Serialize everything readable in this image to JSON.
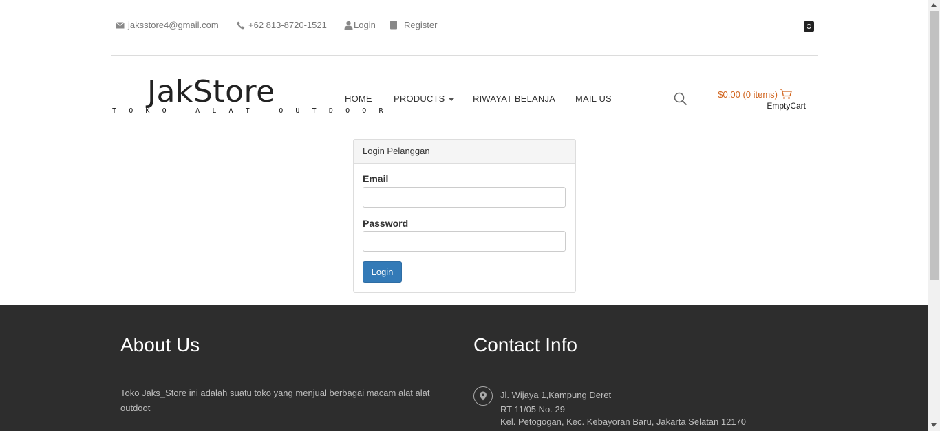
{
  "topbar": {
    "email": "jaksstore4@gmail.com",
    "phone": "+62 813-8720-1521",
    "login": "Login",
    "register": "Register",
    "social_icon": "instagram-icon"
  },
  "brand": {
    "name": "JakStore",
    "tagline": "TOKO ALAT OUTDOOR"
  },
  "nav": {
    "home": "HOME",
    "products": "PRODUCTS",
    "history": "RIWAYAT BELANJA",
    "mail": "MAIL US"
  },
  "cart": {
    "total": "$0.00 (0 items)",
    "empty": "EmptyCart"
  },
  "login_panel": {
    "title": "Login Pelanggan",
    "email_label": "Email",
    "password_label": "Password",
    "button": "Login"
  },
  "footer": {
    "about_title": "About Us",
    "about_text": "Toko Jaks_Store ini adalah suatu toko yang menjual berbagai macam alat alat outdoot",
    "contact_title": "Contact Info",
    "address_line1": "Jl. Wijaya 1,Kampung Deret",
    "address_line2": "RT 11/05 No. 29",
    "address_line3": "Kel. Petogogan, Kec. Kebayoran Baru, Jakarta Selatan 12170"
  },
  "colors": {
    "accent_orange": "#d1641d",
    "button_blue": "#337ab7",
    "footer_bg": "#2d2d2d"
  }
}
